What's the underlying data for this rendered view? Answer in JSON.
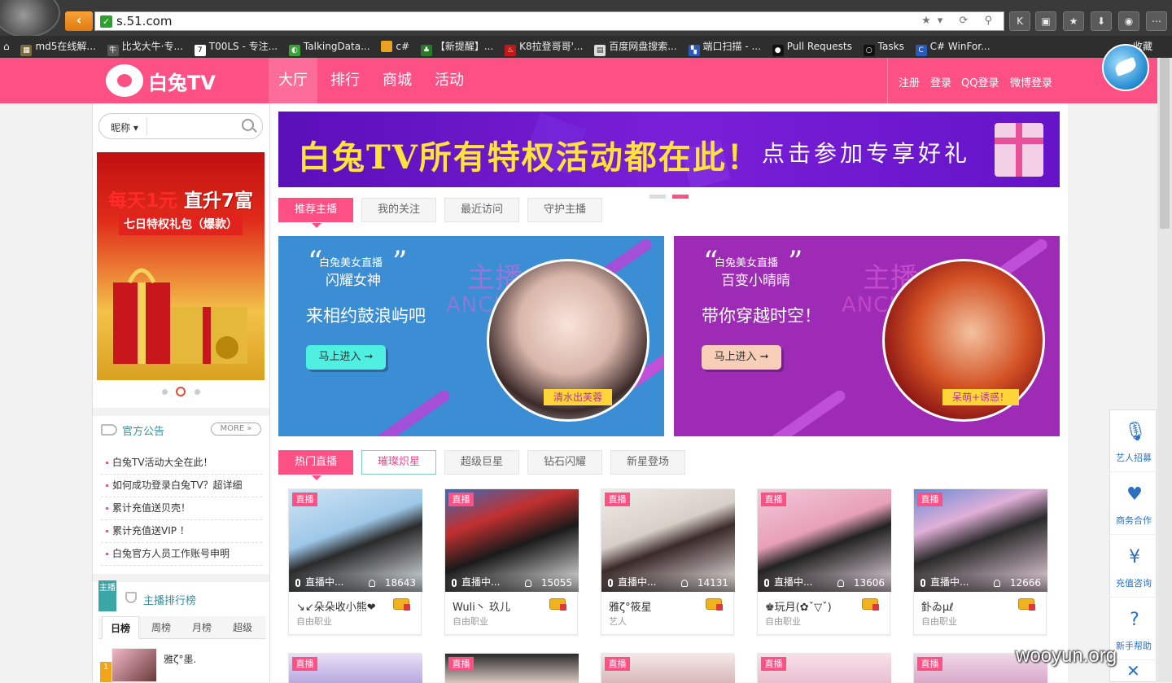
{
  "browser": {
    "url": "s.51.com",
    "bookmarks": [
      "md5在线解...",
      "比戈大牛·专...",
      "T00LS - 专注...",
      "TalkingData...",
      "c#",
      "【新提醒】...",
      "K8拉登哥哥'...",
      "百度网盘搜索...",
      "端口扫描 - ...",
      "Pull Requests",
      "Tasks",
      "C# WinFor...",
      "收藏"
    ]
  },
  "header": {
    "logo_text": "白兔TV",
    "nav": [
      "大厅",
      "排行",
      "商城",
      "活动"
    ],
    "auth": [
      "注册",
      "登录",
      "QQ登录",
      "微博登录"
    ]
  },
  "sidebar": {
    "search": {
      "selector": "昵称"
    },
    "promo": {
      "title_a": "每天1元",
      "title_b": "直升7富",
      "subtitle": "七日特权礼包（爆款）"
    },
    "notice": {
      "title": "官方公告",
      "more": "MORE",
      "items": [
        "白兔TV活动大全在此！",
        "如何成功登录白兔TV？超详细",
        "累计充值送贝壳！",
        "累计充值送VIP ！",
        "白兔官方人员工作账号申明"
      ]
    },
    "ranking": {
      "ribbon": "主播",
      "title": "主播排行榜",
      "tabs": [
        "日榜",
        "周榜",
        "月榜",
        "超级"
      ],
      "first": {
        "rank": "1",
        "name": "雅ζ°墨."
      }
    }
  },
  "main": {
    "banner": {
      "headline": "白兔TV所有特权活动都在此！",
      "sub": "点击参加专享好礼"
    },
    "rec_tabs": [
      "推荐主播",
      "我的关注",
      "最近访问",
      "守护主播"
    ],
    "features": [
      {
        "tag": "白兔美女直播",
        "name": "闪耀女神",
        "slogan": "来相约鼓浪屿吧",
        "anchor_cn": "主播",
        "anchor_en": "ANCHOR",
        "button": "马上进入 ➞",
        "caption": "清水出芙蓉"
      },
      {
        "tag": "白兔美女直播",
        "name": "百变小晴晴",
        "slogan": "带你穿越时空！",
        "anchor_cn": "主播",
        "anchor_en": "ANCHOR",
        "button": "马上进入 ➞",
        "caption": "呆萌+诱惑！"
      }
    ],
    "hot_tabs": [
      "热门直播",
      "璀璨炽星",
      "超级巨星",
      "钻石闪耀",
      "新星登场"
    ],
    "live_label": "直播",
    "status_label": "直播中...",
    "cards": [
      {
        "name": "↘↙朵朵收小熊❤",
        "role": "自由职业",
        "viewers": "18643"
      },
      {
        "name": "Wuli丶 玖儿",
        "role": "自由职业",
        "viewers": "15055"
      },
      {
        "name": "雅ζ°筱星",
        "role": "艺人",
        "viewers": "14131"
      },
      {
        "name": "♚玩月(✿ˇ▽ˇ)",
        "role": "自由职业",
        "viewers": "13606"
      },
      {
        "name": "釙ゐμℓ",
        "role": "自由职业",
        "viewers": "12666"
      }
    ]
  },
  "float_bar": {
    "items": [
      "艺人招募",
      "商务合作",
      "充值咨询",
      "新手帮助"
    ],
    "close": "✕"
  },
  "watermark": "wooyun.org",
  "colors": {
    "brand": "#fd5186",
    "teal": "#3a8f9a",
    "banner": "#6514c8"
  }
}
